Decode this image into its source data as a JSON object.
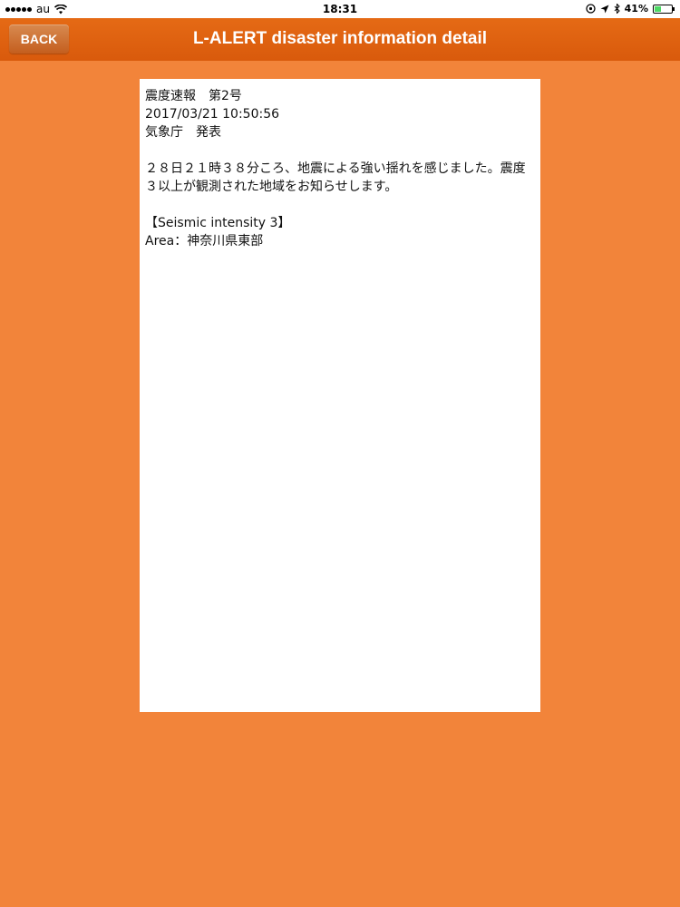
{
  "status_bar": {
    "carrier": "au",
    "time": "18:31",
    "battery_percent": "41%",
    "battery_level": 0.41
  },
  "nav": {
    "back_label": "BACK",
    "title": "L-ALERT disaster information detail"
  },
  "detail": {
    "line1": "震度速報　第2号",
    "line2": "2017/03/21 10:50:56",
    "line3": "気象庁　発表",
    "message": "２８日２１時３８分ころ、地震による強い揺れを感じました。震度３以上が観測された地域をお知らせします。",
    "intensity_heading": "【Seismic intensity 3】",
    "area": "Area：神奈川県東部"
  },
  "icons": [
    "signal-icon",
    "wifi-icon",
    "location-lock-icon",
    "location-arrow-icon",
    "bluetooth-icon",
    "battery-icon"
  ]
}
